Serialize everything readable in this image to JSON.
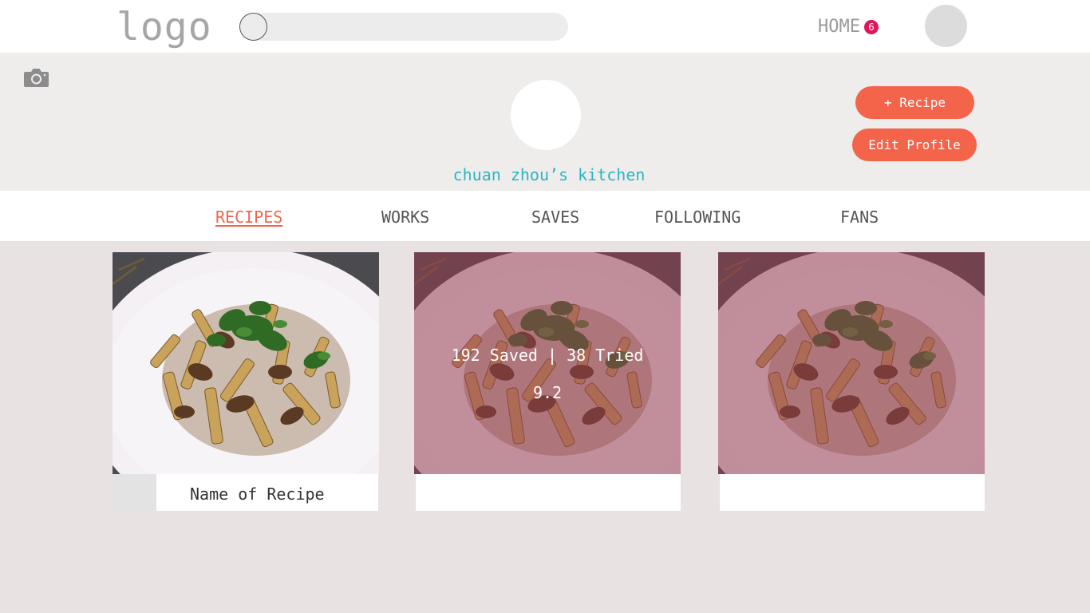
{
  "header": {
    "logo": "logo",
    "search_placeholder": "",
    "home_label": "HOME",
    "notification_count": "6"
  },
  "profile": {
    "kitchen_name": "chuan zhou’s kitchen",
    "add_recipe_label": "+ Recipe",
    "edit_profile_label": "Edit Profile"
  },
  "tabs": [
    {
      "label": "RECIPES",
      "active": true
    },
    {
      "label": "WORKS",
      "active": false
    },
    {
      "label": "SAVES",
      "active": false
    },
    {
      "label": "FOLLOWING",
      "active": false
    },
    {
      "label": "FANS",
      "active": false
    }
  ],
  "cards": [
    {
      "name": "Name of Recipe",
      "stats": "",
      "score": ""
    },
    {
      "name": "",
      "stats": "192 Saved | 38 Tried",
      "score": "9.2"
    },
    {
      "name": "",
      "stats": "",
      "score": ""
    }
  ],
  "colors": {
    "accent": "#f4644b",
    "kitchen_name": "#2bb5c3",
    "badge": "#e0165a",
    "overlay": "#963c50"
  }
}
